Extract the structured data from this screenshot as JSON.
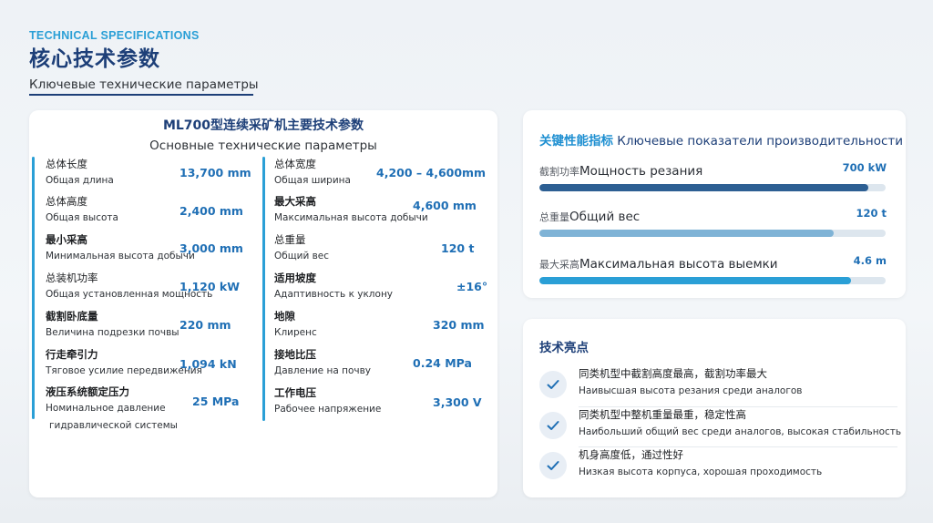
{
  "header": {
    "eyebrow": "TECHNICAL SPECIFICATIONS",
    "title": "核心技术参数",
    "subtitle": "Ключевые технические параметры"
  },
  "spec_card": {
    "title": "ML700型连续采矿机主要技术参数",
    "subtitle": "Основные технические параметры",
    "left_rows": [
      {
        "cn": "总体长度",
        "ru": "Общая длина",
        "value": "13,700 mm"
      },
      {
        "cn": "总体高度",
        "ru": "Общая высота",
        "value": "2,400 mm"
      },
      {
        "cn": "最小采高",
        "ru": "Минимальная высота добычи",
        "value": "3,000 mm"
      },
      {
        "cn": "总装机功率",
        "ru": "Общая установленная мощность",
        "value": "1,120 kW"
      },
      {
        "cn": "截割卧底量",
        "ru": "Величина подрезки почвы",
        "value": "220 mm"
      },
      {
        "cn": "行走牵引力",
        "ru": "Тяговое усилие передвижения",
        "value": "1,094 kN"
      },
      {
        "cn": "液压系统额定压力",
        "ru": "Номинальное давление",
        "ru2": "гидравлической системы",
        "value": "25 MPa"
      }
    ],
    "right_rows": [
      {
        "cn": "总体宽度",
        "ru": "Общая ширина",
        "value": "4,200 – 4,600mm"
      },
      {
        "cn": "最大采高",
        "ru": "Максимальная высота добычи",
        "value": "4,600 mm"
      },
      {
        "cn": "总重量",
        "ru": "Общий вес",
        "value": "120 t"
      },
      {
        "cn": "适用坡度",
        "ru": "Адаптивность к уклону",
        "value": "±16°"
      },
      {
        "cn": "地隙",
        "ru": "Клиренс",
        "value": "320 mm"
      },
      {
        "cn": "接地比压",
        "ru": "Давление на почву",
        "value": "0.24 MPa"
      },
      {
        "cn": "工作电压",
        "ru": "Рабочее напряжение",
        "value": "3,300 V"
      }
    ]
  },
  "performance": {
    "title_cn": "关键性能指标",
    "title_ru": "Ключевые показатели производительности",
    "metrics": [
      {
        "cn": "截割功率",
        "ru": "Мощность резания",
        "value": "700 kW",
        "fill_fraction": 0.95,
        "color": "#2d5f93"
      },
      {
        "cn": "总重量",
        "ru": "Общий вес",
        "value": "120 t",
        "fill_fraction": 0.85,
        "color": "#7fb3d6"
      },
      {
        "cn": "最大采高",
        "ru": "Максимальная высота выемки",
        "value": "4.6 m",
        "fill_fraction": 0.9,
        "color": "#2a9fd6"
      }
    ]
  },
  "highlights": {
    "title": "技术亮点",
    "items": [
      {
        "cn": "同类机型中截割高度最高，截割功率最大",
        "ru": "Наивысшая высота резания среди аналогов"
      },
      {
        "cn": "同类机型中整机重量最重，稳定性高",
        "ru": "Наибольший общий вес среди аналогов, высокая стабильность"
      },
      {
        "cn": "机身高度低，通过性好",
        "ru": "Низкая высота корпуса, хорошая проходимость"
      }
    ]
  },
  "colors": {
    "accent": "#2a9fd6",
    "title_navy": "#1d3f78",
    "value_blue": "#1f6fb5"
  }
}
